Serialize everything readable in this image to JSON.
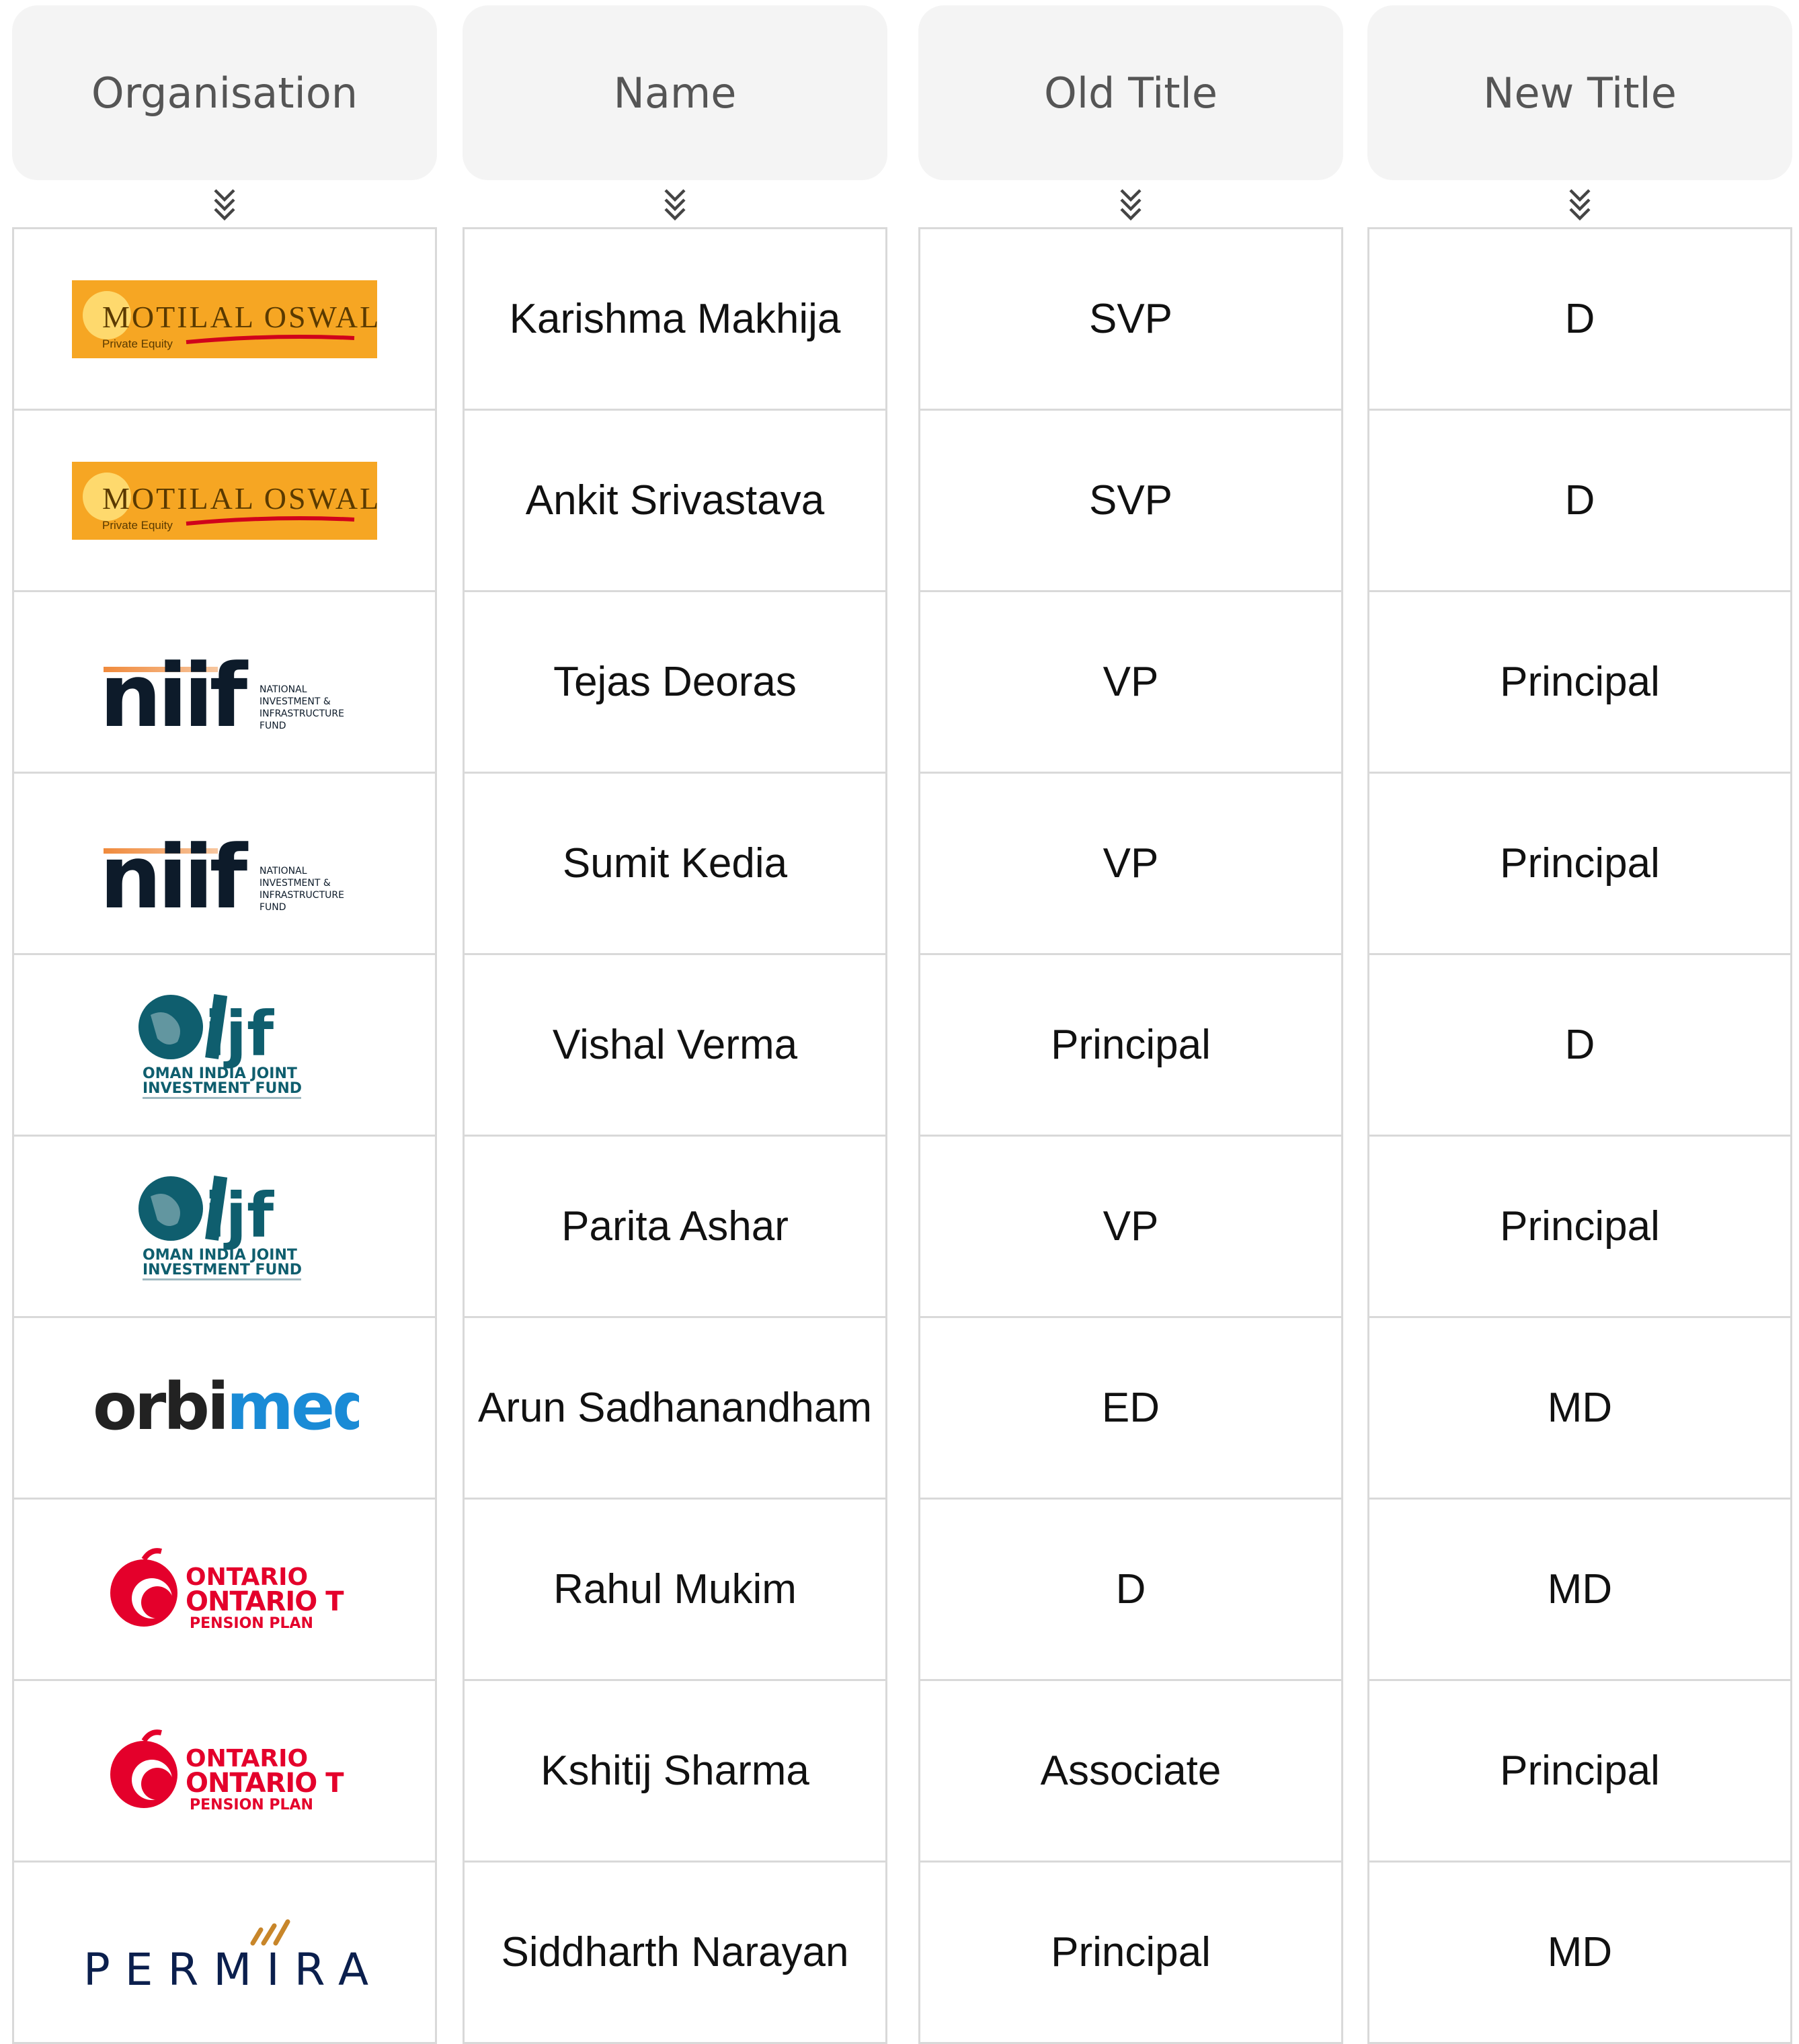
{
  "headers": {
    "organisation": "Organisation",
    "name": "Name",
    "old_title": "Old Title",
    "new_title": "New Title"
  },
  "rows": [
    {
      "org_logo": "motilal-oswal-logo",
      "org_text": "MOTILAL OSWAL",
      "org_sub": "Private Equity",
      "name": "Karishma Makhija",
      "old": "SVP",
      "new": "D"
    },
    {
      "org_logo": "motilal-oswal-logo",
      "org_text": "MOTILAL OSWAL",
      "org_sub": "Private Equity",
      "name": "Ankit Srivastava",
      "old": "SVP",
      "new": "D"
    },
    {
      "org_logo": "niif-logo",
      "org_text": "niif",
      "org_sub": "NATIONAL INVESTMENT & INFRASTRUCTURE FUND",
      "name": "Tejas Deoras",
      "old": "VP",
      "new": "Principal"
    },
    {
      "org_logo": "niif-logo",
      "org_text": "niif",
      "org_sub": "NATIONAL INVESTMENT & INFRASTRUCTURE FUND",
      "name": "Sumit Kedia",
      "old": "VP",
      "new": "Principal"
    },
    {
      "org_logo": "oijif-logo",
      "org_text": "OMAN INDIA JOINT",
      "org_sub": "INVESTMENT FUND",
      "name": "Vishal Verma",
      "old": "Principal",
      "new": "D"
    },
    {
      "org_logo": "oijif-logo",
      "org_text": "OMAN INDIA JOINT",
      "org_sub": "INVESTMENT FUND",
      "name": "Parita Ashar",
      "old": "VP",
      "new": "Principal"
    },
    {
      "org_logo": "orbimed-logo",
      "org_text": "orbimed",
      "org_sub": "",
      "name": "Arun Sadhanandham",
      "old": "ED",
      "new": "MD"
    },
    {
      "org_logo": "otpp-logo",
      "org_text": "ONTARIO TEACHERS'",
      "org_sub": "PENSION PLAN",
      "name": "Rahul Mukim",
      "old": "D",
      "new": "MD"
    },
    {
      "org_logo": "otpp-logo",
      "org_text": "ONTARIO TEACHERS'",
      "org_sub": "PENSION PLAN",
      "name": "Kshitij Sharma",
      "old": "Associate",
      "new": "Principal"
    },
    {
      "org_logo": "permira-logo",
      "org_text": "PERMIRA",
      "org_sub": "",
      "name": "Siddharth Narayan",
      "old": "Principal",
      "new": "MD"
    }
  ],
  "colors": {
    "header_bg": "#f4f4f4",
    "border": "#d9d9d9",
    "motilal_orange": "#f6a623",
    "niif_navy": "#0d1b2a",
    "oijif_teal": "#0f5e6e",
    "orbimed_blue": "#1a8bd6",
    "otpp_red": "#e4002b",
    "permira_navy": "#0b1f4d"
  },
  "icons": {
    "sort": "chevron-double-down-icon"
  }
}
